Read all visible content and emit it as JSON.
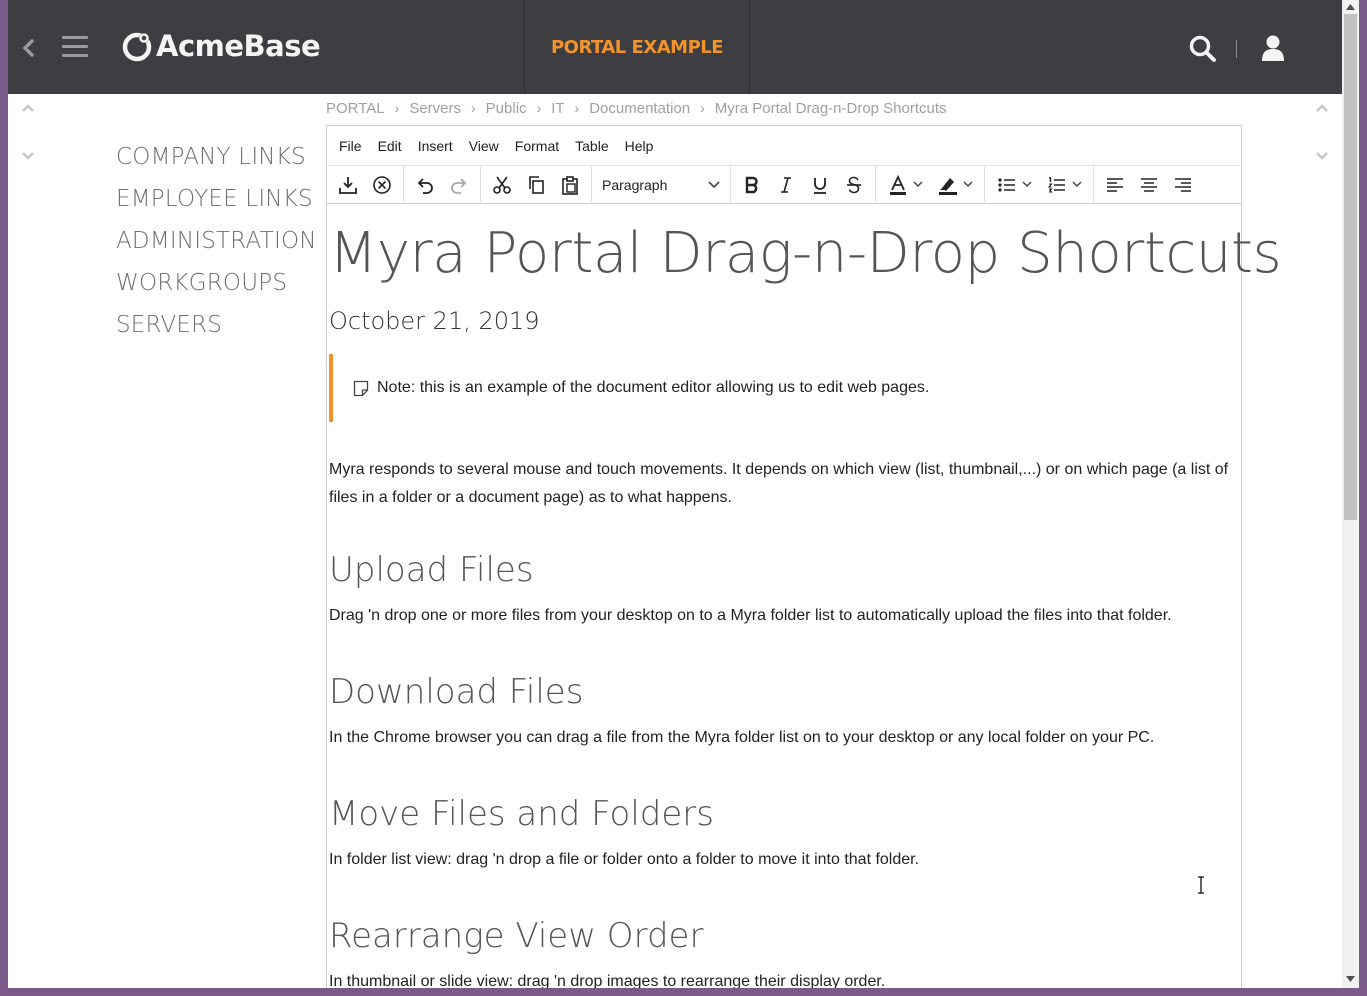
{
  "topbar": {
    "logo_text": "AcmeBase",
    "portal_title": "PORTAL EXAMPLE",
    "icons": [
      "back-icon",
      "menu-icon",
      "search-icon",
      "user-icon"
    ]
  },
  "sidebar": {
    "items": [
      "COMPANY LINKS",
      "EMPLOYEE LINKS",
      "ADMINISTRATION",
      "WORKGROUPS",
      "SERVERS"
    ]
  },
  "breadcrumb": [
    "PORTAL",
    "Servers",
    "Public",
    "IT",
    "Documentation",
    "Myra Portal Drag-n-Drop Shortcuts"
  ],
  "editor": {
    "menus": [
      "File",
      "Edit",
      "Insert",
      "View",
      "Format",
      "Table",
      "Help"
    ],
    "format_select": "Paragraph",
    "toolbar_icons": [
      "save-icon",
      "cancel-icon",
      "undo-icon",
      "redo-icon",
      "cut-icon",
      "copy-icon",
      "paste-icon",
      "bold-icon",
      "italic-icon",
      "underline-icon",
      "strikethrough-icon",
      "text-color-icon",
      "highlight-color-icon",
      "bullet-list-icon",
      "numbered-list-icon",
      "align-left-icon",
      "align-center-icon",
      "align-right-icon"
    ]
  },
  "document": {
    "title": "Myra Portal Drag-n-Drop Shortcuts",
    "date": "October 21, 2019",
    "note": "Note: this is an example of the document editor allowing us to edit web pages.",
    "intro": "Myra responds to several mouse and touch movements. It depends on which view (list, thumbnail,...) or on which page (a list of files in a folder or a document page) as to what happens.",
    "sections": [
      {
        "heading": "Upload Files",
        "body": "Drag 'n drop one or more files from your desktop on to a Myra folder list to automatically upload the files into that folder."
      },
      {
        "heading": "Download Files",
        "body": "In the Chrome browser you can drag a file from the Myra folder list on to your desktop or any local folder on your PC."
      },
      {
        "heading": "Move Files and Folders",
        "body": "In folder list view: drag 'n drop a file or folder onto a folder to move it into that folder."
      },
      {
        "heading": "Rearrange View Order",
        "body": "In thumbnail or slide view: drag 'n drop images to rearrange their display order."
      }
    ]
  },
  "colors": {
    "topbar_bg": "#3e3e42",
    "accent": "#f2922b",
    "sidebar_text": "#6e6e6e",
    "breadcrumb_text": "#a0a0a0"
  }
}
